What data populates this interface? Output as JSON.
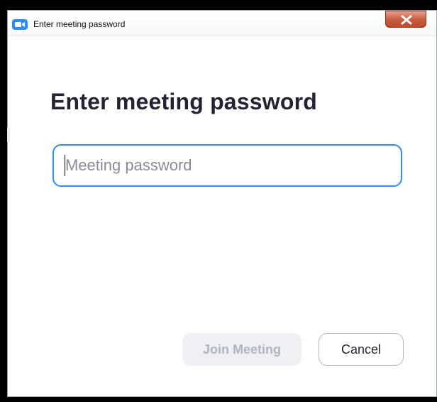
{
  "window": {
    "title": "Enter meeting password",
    "close_label": "X",
    "app_icon": "video-camera-icon"
  },
  "dialog": {
    "heading": "Enter meeting password",
    "password_field": {
      "placeholder": "Meeting password",
      "value": ""
    },
    "buttons": {
      "join_label": "Join Meeting",
      "cancel_label": "Cancel"
    }
  },
  "colors": {
    "accent": "#2D8CFF",
    "disabled_button_bg": "#EEF0F3",
    "disabled_button_text": "#B0B6BF",
    "heading_text": "#232333",
    "close_button": "#C65A3C"
  }
}
